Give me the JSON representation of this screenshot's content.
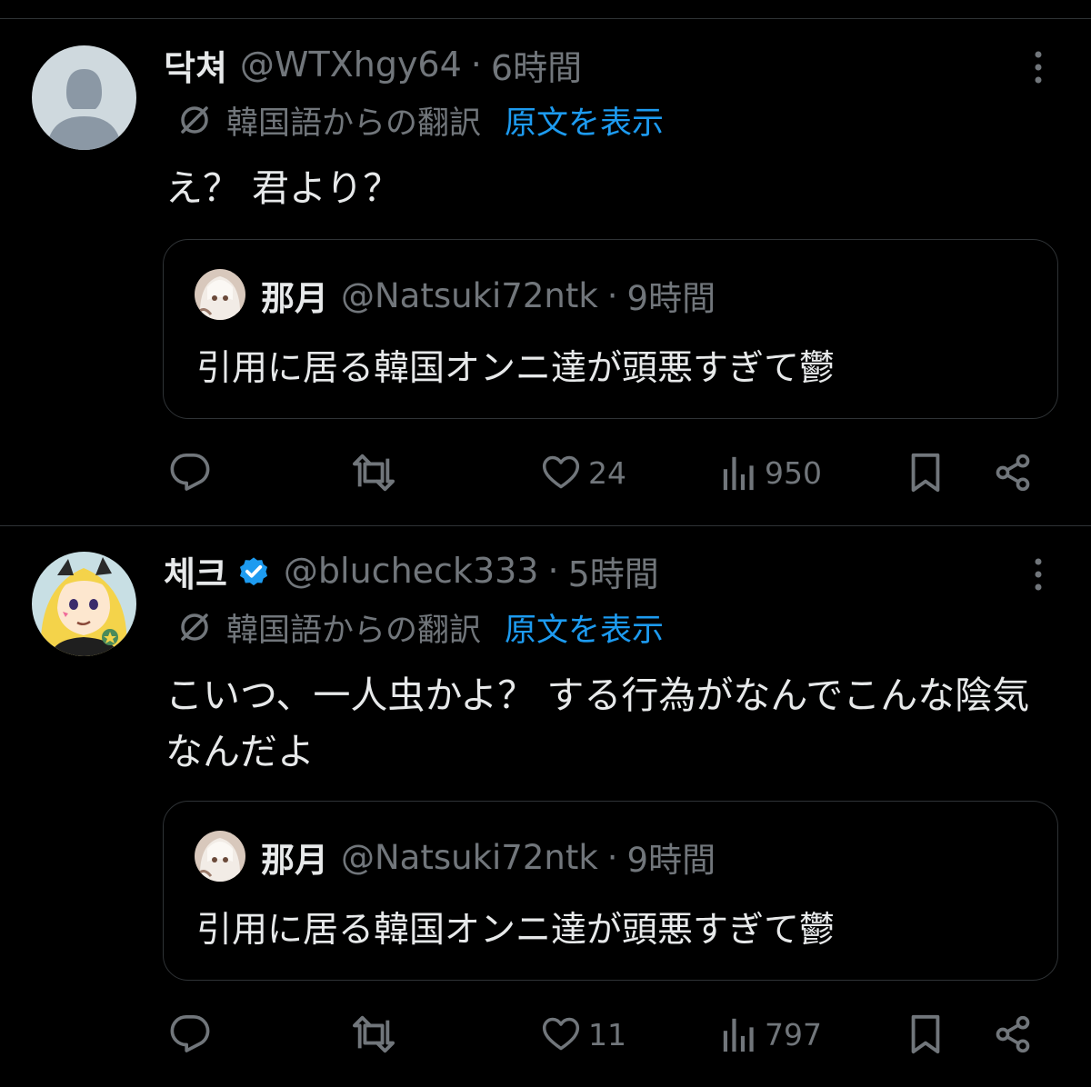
{
  "tweets": [
    {
      "name": "닥쳐",
      "handle": "@WTXhgy64",
      "separator": "·",
      "time": "6時間",
      "verified": false,
      "translation_label": "韓国語からの翻訳",
      "show_original": "原文を表示",
      "text": "え？ 君より？",
      "quote": {
        "name": "那月",
        "handle": "@Natsuki72ntk",
        "separator": "·",
        "time": "9時間",
        "text": "引用に居る韓国オンニ達が頭悪すぎて鬱"
      },
      "actions": {
        "reply_count": "",
        "retweet_count": "",
        "like_count": "24",
        "view_count": "950"
      }
    },
    {
      "name": "체크",
      "handle": "@blucheck333",
      "separator": "·",
      "time": "5時間",
      "verified": true,
      "translation_label": "韓国語からの翻訳",
      "show_original": "原文を表示",
      "text": "こいつ、一人虫かよ？ する行為がなんでこんな陰気なんだよ",
      "quote": {
        "name": "那月",
        "handle": "@Natsuki72ntk",
        "separator": "·",
        "time": "9時間",
        "text": "引用に居る韓国オンニ達が頭悪すぎて鬱"
      },
      "actions": {
        "reply_count": "",
        "retweet_count": "",
        "like_count": "11",
        "view_count": "797"
      }
    }
  ],
  "colors": {
    "background": "#000000",
    "text_primary": "#e7e9ea",
    "text_secondary": "#71767b",
    "link": "#1d9bf0",
    "border": "#2f3336",
    "verified_badge": "#1d9bf0"
  },
  "icons": {
    "translate": "globe-slash-icon",
    "more": "more-vertical-icon",
    "reply": "reply-icon",
    "retweet": "retweet-icon",
    "like": "heart-icon",
    "views": "views-bar-chart-icon",
    "bookmark": "bookmark-icon",
    "share": "share-icon",
    "verified": "verified-badge-icon"
  }
}
